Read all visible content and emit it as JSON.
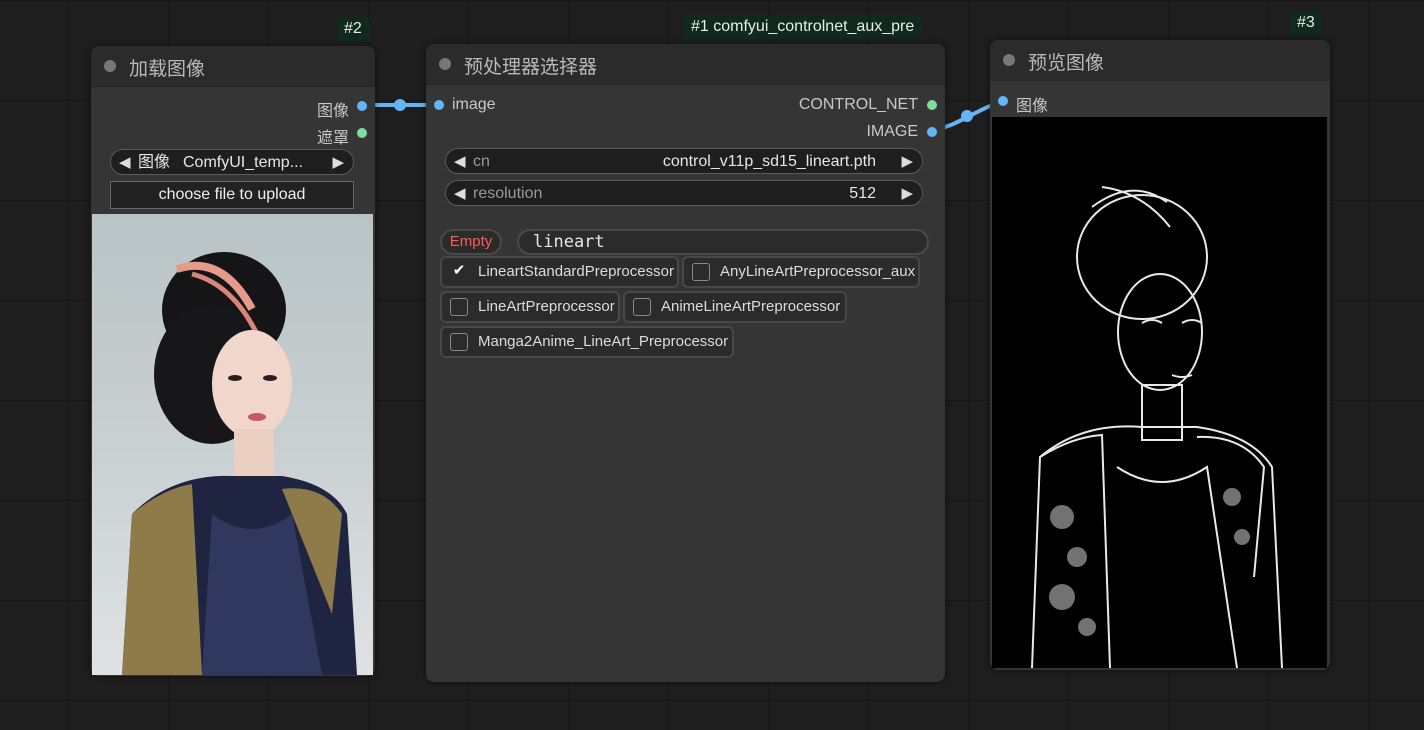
{
  "colors": {
    "link_image": "#64b5f6",
    "link_mask": "#7ddea0",
    "badge_bg": "#0f2a1d",
    "warning": "#ff5a5a"
  },
  "load_node": {
    "badge": "#2",
    "title": "加载图像",
    "outputs": [
      {
        "label": "图像",
        "color": "blue"
      },
      {
        "label": "遮罩",
        "color": "green"
      }
    ],
    "image_combo": {
      "label": "图像",
      "value": "ComfyUI_temp..."
    },
    "upload_button": "choose file to upload",
    "image_alt": "portrait-photo"
  },
  "preprocessor_node": {
    "badge": "#1 comfyui_controlnet_aux_pre",
    "title": "预处理器选择器",
    "input": "image",
    "outputs": [
      {
        "label": "CONTROL_NET",
        "color": "green"
      },
      {
        "label": "IMAGE",
        "color": "blue"
      }
    ],
    "cn_combo": {
      "label": "cn",
      "value": "control_v11p_sd15_lineart.pth"
    },
    "resolution_combo": {
      "label": "resolution",
      "value": "512"
    },
    "empty_button": "Empty",
    "search_value": "lineart",
    "options": [
      {
        "label": "LineartStandardPreprocessor",
        "checked": true
      },
      {
        "label": "AnyLineArtPreprocessor_aux",
        "checked": false
      },
      {
        "label": "LineArtPreprocessor",
        "checked": false
      },
      {
        "label": "AnimeLineArtPreprocessor",
        "checked": false
      },
      {
        "label": "Manga2Anime_LineArt_Preprocessor",
        "checked": false
      }
    ]
  },
  "preview_node": {
    "badge": "#3",
    "title": "预览图像",
    "input": "图像",
    "image_alt": "lineart-result"
  },
  "icons": {
    "left_arrow": "◀",
    "right_arrow": "▶",
    "check": "✔"
  }
}
